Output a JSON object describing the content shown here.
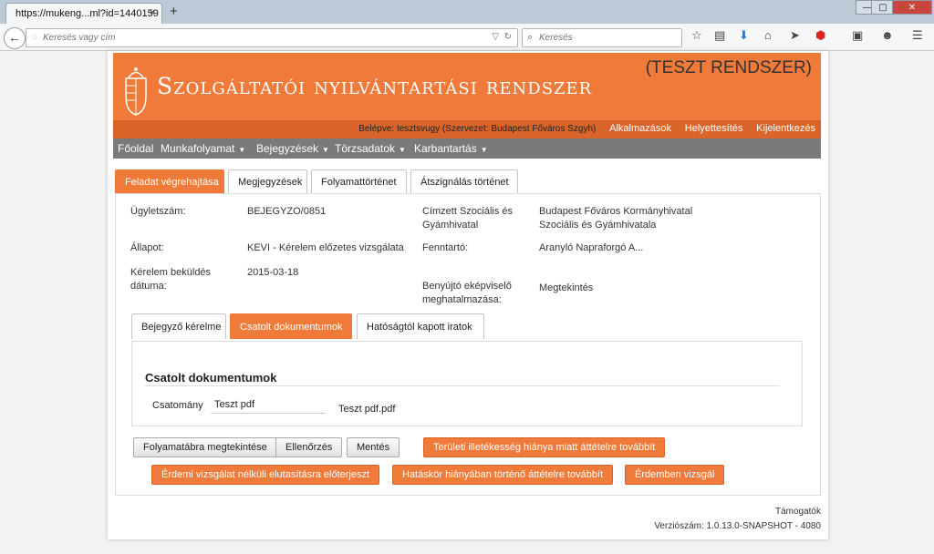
{
  "browser": {
    "tab_title": "https://mukeng...ml?id=1440159",
    "tab_close": "×",
    "new_tab": "+",
    "url_placeholder": "Keresés vagy cím",
    "search_placeholder": "Keresés",
    "win_min": "—",
    "win_max": "▢",
    "win_close": "✕"
  },
  "header": {
    "system_title": "Szolgáltatói nyilvántartási rendszer",
    "test_label": "(TESZT RENDSZER)",
    "logged_in": "Belépve: tesztsvugy (Szervezet: Budapest Főváros Szgyh)",
    "links": [
      "Alkalmazások",
      "Helyettesítés",
      "Kijelentkezés"
    ]
  },
  "menu": {
    "items": [
      "Főoldal",
      "Munkafolyamat",
      "Bejegyzések",
      "Törzsadatok",
      "Karbantartás"
    ]
  },
  "tabs": {
    "items": [
      "Feladat végrehajtása",
      "Megjegyzések",
      "Folyamattörténet",
      "Átszignálás történet"
    ],
    "active": 0
  },
  "fields": {
    "ugyletszam_label": "Ügyletszám:",
    "ugyletszam_value": "BEJEGYZO/0851",
    "allapot_label": "Állapot:",
    "allapot_value": "KEVI - Kérelem előzetes vizsgálata",
    "bekuldes_label_1": "Kérelem beküldés",
    "bekuldes_label_2": "dátuma:",
    "bekuldes_value": "2015-03-18",
    "cimzett_label_1": "Címzett Szociális és",
    "cimzett_label_2": "Gyámhivatal",
    "cimzett_value_1": "Budapest Főváros Kormányhivatal",
    "cimzett_value_2": "Szociális és Gyámhivatala",
    "fenntarto_label": "Fenntartó:",
    "fenntarto_value": "Aranyló Napraforgó A...",
    "benyujto_label_1": "Benyújtó eképviselő",
    "benyujto_label_2": "meghatalmazása:",
    "benyujto_value": "Megtekintés"
  },
  "subtabs": {
    "items": [
      "Bejegyző kérelme",
      "Csatolt dokumentumok",
      "Hatóságtól kapott iratok"
    ],
    "active": 1
  },
  "attachments": {
    "title": "Csatolt dokumentumok",
    "label": "Csatomány",
    "input_value": "Teszt pdf",
    "file_name": "Teszt pdf.pdf"
  },
  "buttons": {
    "folyamatabra": "Folyamatábra megtekintése",
    "ellenorzes": "Ellenőrzés",
    "mentes": "Mentés",
    "teruleti": "Területi illetékesség hiánya miatt áttételre továbbít",
    "erdemi_nelkuli": "Érdemi vizsgálat nélküli elutasításra előterjeszt",
    "hataskor": "Hatáskör hiányában történő áttételre továbbít",
    "erdemben": "Érdemben vizsgál"
  },
  "footer": {
    "support": "Támogatók",
    "version": "Verziószám: 1.0.13.0-SNAPSHOT - 4080"
  },
  "colors": {
    "accent": "#f07a3a",
    "accent_dark": "#d9652a",
    "menu_bg": "#7a7a7a"
  },
  "icons": [
    "back-arrow-icon",
    "globe-icon",
    "dropdown-icon",
    "reload-icon",
    "search-icon",
    "star-icon",
    "reader-icon",
    "download-icon",
    "home-icon",
    "send-icon",
    "adblock-icon",
    "screenshot-icon",
    "chat-icon",
    "hamburger-menu-icon",
    "coat-of-arms-icon"
  ]
}
